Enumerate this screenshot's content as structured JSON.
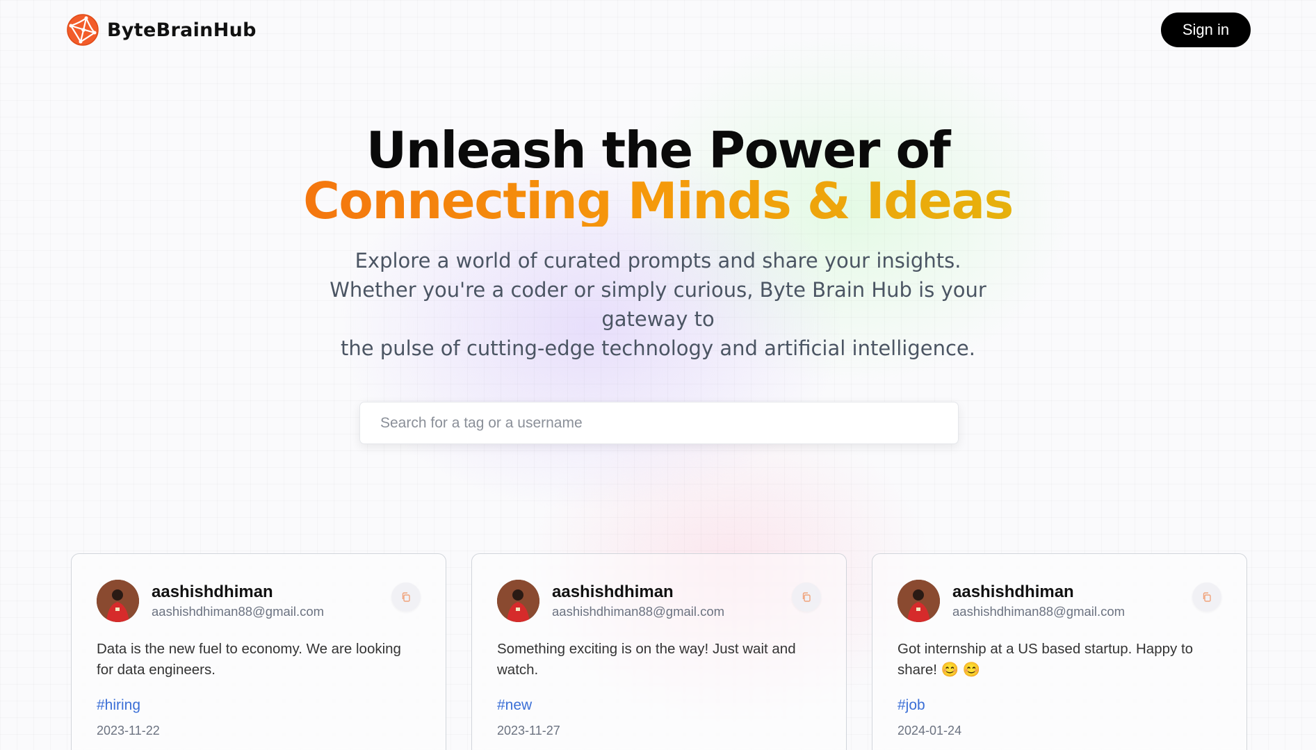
{
  "nav": {
    "brand_name": "ByteBrainHub",
    "signin_label": "Sign in"
  },
  "hero": {
    "title_line1": "Unleash the Power of",
    "title_line2": "Connecting Minds & Ideas",
    "description_lines": [
      "Explore a world of curated prompts and share your insights.",
      "Whether you're a coder or simply curious, Byte Brain Hub is your gateway to",
      "the pulse of cutting-edge technology and artificial intelligence."
    ]
  },
  "search": {
    "placeholder": "Search for a tag or a username",
    "value": ""
  },
  "colors": {
    "accent_gradient_start": "#f4760e",
    "accent_gradient_end": "#e6b10c",
    "tag_color": "#3b6fd6",
    "button_bg": "#000000"
  },
  "cards": [
    {
      "username": "aashishdhiman",
      "email": "aashishdhiman88@gmail.com",
      "prompt": "Data is the new fuel to economy. We are looking for data engineers.",
      "tag": "#hiring",
      "date": "2023-11-22",
      "copy_icon": "copy-icon"
    },
    {
      "username": "aashishdhiman",
      "email": "aashishdhiman88@gmail.com",
      "prompt": "Something exciting is on the way! Just wait and watch.",
      "tag": "#new",
      "date": "2023-11-27",
      "copy_icon": "copy-icon"
    },
    {
      "username": "aashishdhiman",
      "email": "aashishdhiman88@gmail.com",
      "prompt": "Got internship at a US based startup. Happy to share! 😊 😊",
      "tag": "#job",
      "date": "2024-01-24",
      "copy_icon": "copy-icon"
    }
  ]
}
